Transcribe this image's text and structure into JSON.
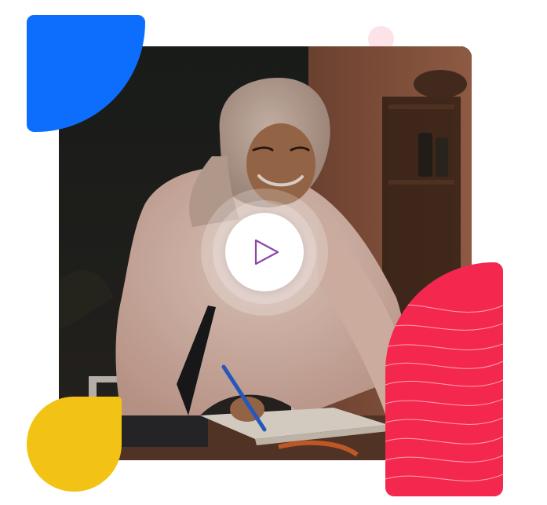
{
  "hero_media": {
    "play_icon": "play-icon",
    "colors": {
      "blue_shape": "#0d6efd",
      "yellow_shape": "#f2c314",
      "red_shape": "#f4284f",
      "pink_dot": "#fde2e8",
      "play_icon_stroke": "#8e44ad",
      "play_button_bg": "#ffffff"
    }
  }
}
